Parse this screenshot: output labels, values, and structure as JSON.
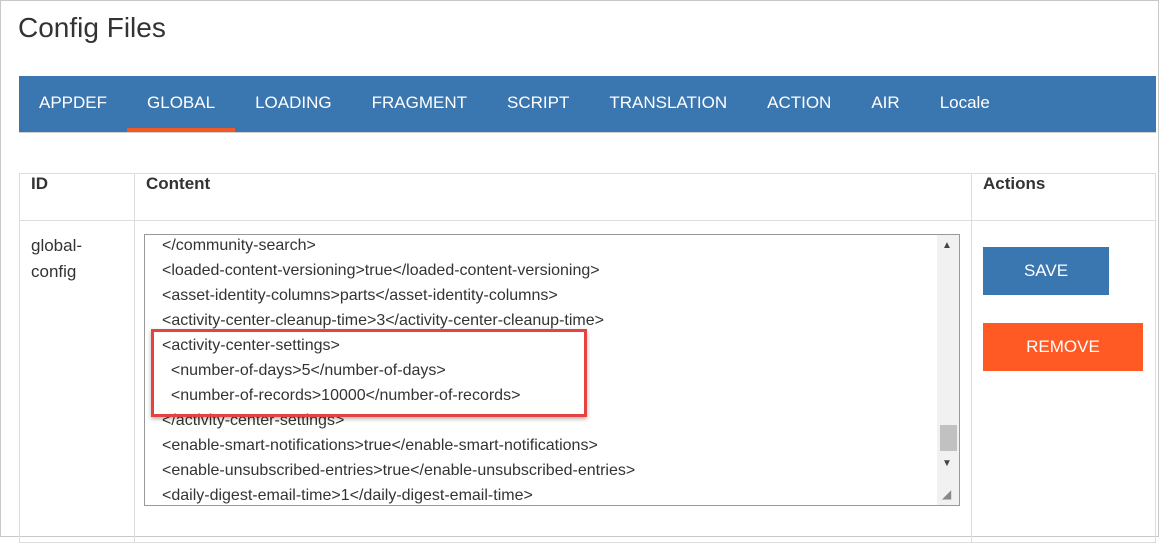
{
  "page_title": "Config Files",
  "tabs": [
    {
      "label": "APPDEF"
    },
    {
      "label": "GLOBAL",
      "active": true
    },
    {
      "label": "LOADING"
    },
    {
      "label": "FRAGMENT"
    },
    {
      "label": "SCRIPT"
    },
    {
      "label": "TRANSLATION"
    },
    {
      "label": "ACTION"
    },
    {
      "label": "AIR"
    },
    {
      "label": "Locale"
    }
  ],
  "table": {
    "headers": {
      "id": "ID",
      "content": "Content",
      "actions": "Actions"
    },
    "row": {
      "id": "global-config",
      "content_lines": [
        "</community-search>",
        "<loaded-content-versioning>true</loaded-content-versioning>",
        "<asset-identity-columns>parts</asset-identity-columns>",
        "<activity-center-cleanup-time>3</activity-center-cleanup-time>",
        "<activity-center-settings>",
        "  <number-of-days>5</number-of-days>",
        "  <number-of-records>10000</number-of-records>",
        "</activity-center-settings>",
        "<enable-smart-notifications>true</enable-smart-notifications>",
        "<enable-unsubscribed-entries>true</enable-unsubscribed-entries>",
        "<daily-digest-email-time>1</daily-digest-email-time>"
      ],
      "save_label": "SAVE",
      "remove_label": "REMOVE"
    }
  },
  "colors": {
    "tab_bar": "#3a76af",
    "active_tab_underline": "#f15a24",
    "save": "#3a76af",
    "remove": "#ff5a24",
    "highlight_box": "#e84141"
  }
}
